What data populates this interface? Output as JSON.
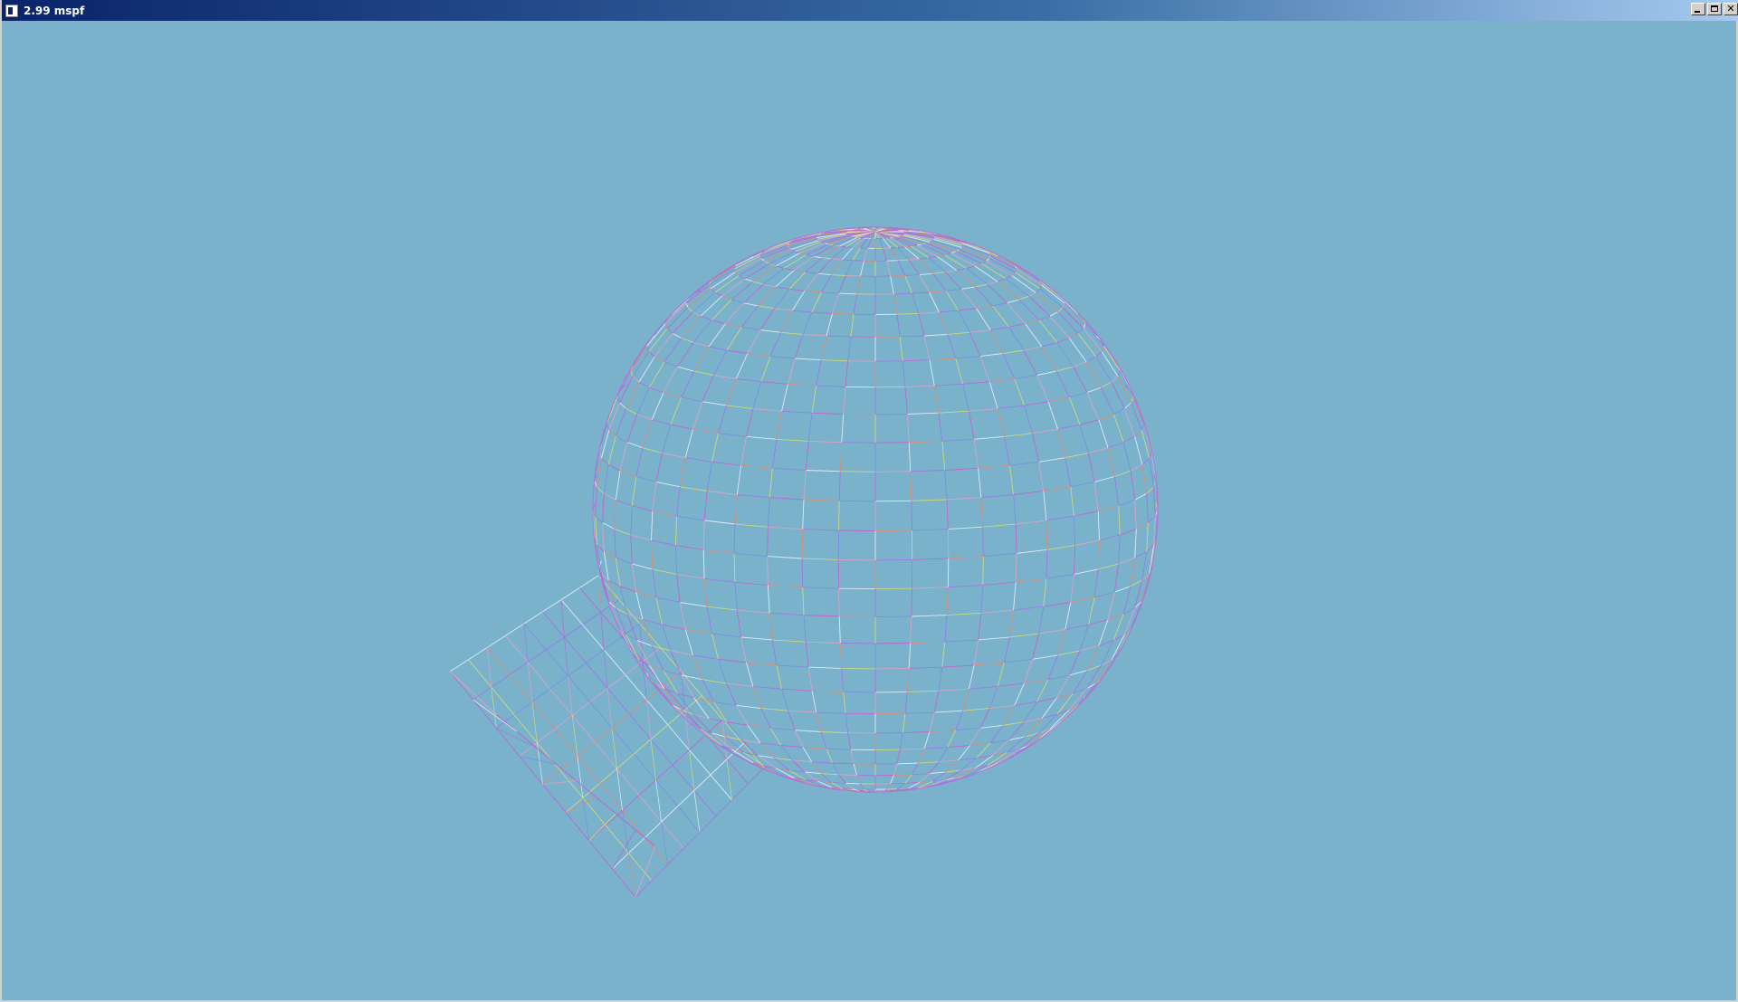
{
  "window": {
    "title": "2.99 mspf",
    "icon": "app-icon",
    "controls": {
      "minimize_icon": "minimize-icon",
      "maximize_icon": "maximize-icon",
      "close_label": "✕"
    }
  },
  "scene": {
    "background": "#7ab2cc",
    "objects": [
      "wireframe-sphere",
      "wireframe-box"
    ],
    "palette": [
      "#e08a6a",
      "#d8e070",
      "#c85ad0",
      "#f0f4ff",
      "#a070e8",
      "#7a8ae0",
      "#e8a0c8"
    ]
  }
}
